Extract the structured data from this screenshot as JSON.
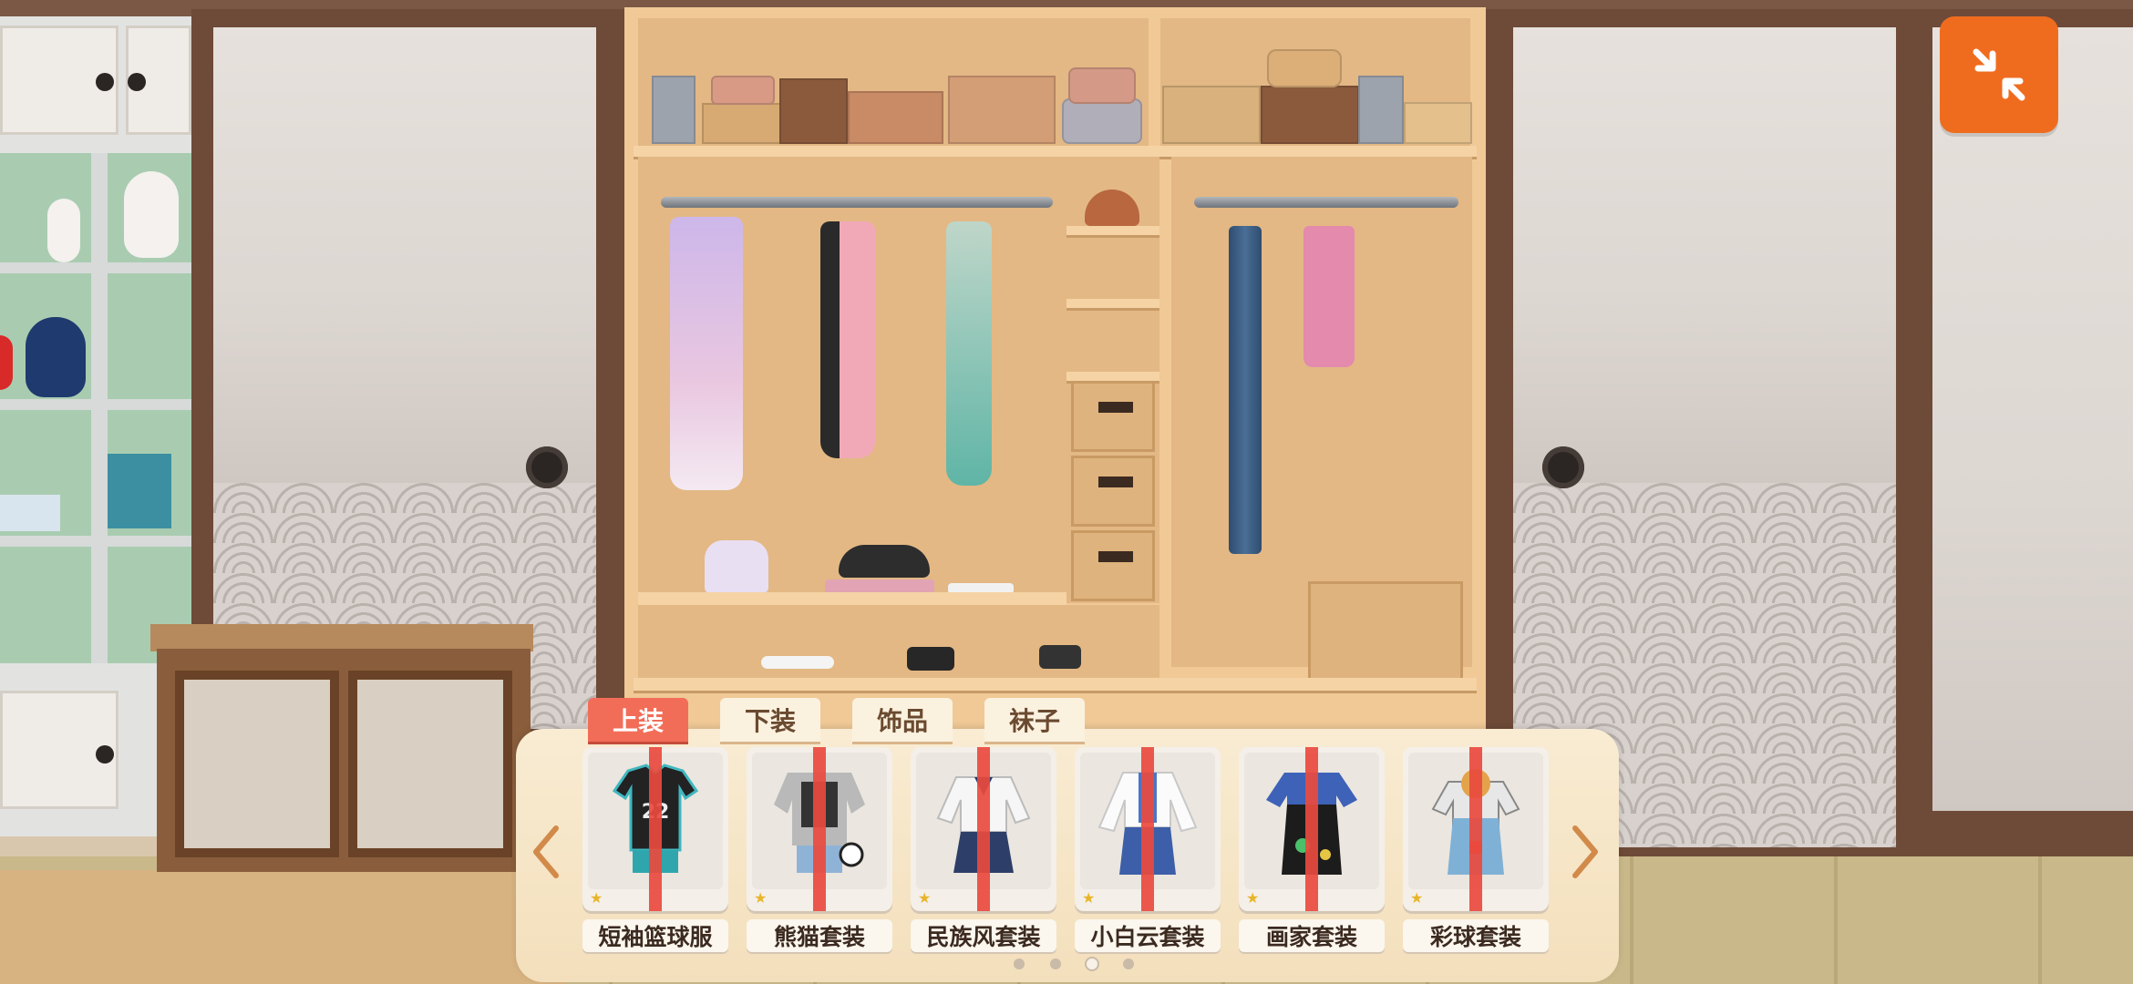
{
  "tabs": [
    {
      "label": "上装",
      "active": true
    },
    {
      "label": "下装",
      "active": false
    },
    {
      "label": "饰品",
      "active": false
    },
    {
      "label": "袜子",
      "active": false
    }
  ],
  "items": [
    {
      "name": "短袖篮球服",
      "icon": "basketball-uniform-icon",
      "rarity": "★"
    },
    {
      "name": "熊猫套装",
      "icon": "panda-outfit-icon",
      "rarity": "★"
    },
    {
      "name": "民族风套装",
      "icon": "ethnic-outfit-icon",
      "rarity": "★"
    },
    {
      "name": "小白云套装",
      "icon": "white-cloud-outfit-icon",
      "rarity": "★"
    },
    {
      "name": "画家套装",
      "icon": "painter-outfit-icon",
      "rarity": "★"
    },
    {
      "name": "彩球套装",
      "icon": "color-ball-outfit-icon",
      "rarity": "★"
    }
  ],
  "pagination": {
    "total": 4,
    "current": 3
  },
  "controls": {
    "collapse": "collapse-icon",
    "prev": "chevron-left-icon",
    "next": "chevron-right-icon"
  },
  "colors": {
    "accent": "#ef6c1f",
    "active_tab": "#f26d58",
    "panel": "#f9ecd3",
    "wardrobe_wood": "#f0c996"
  }
}
